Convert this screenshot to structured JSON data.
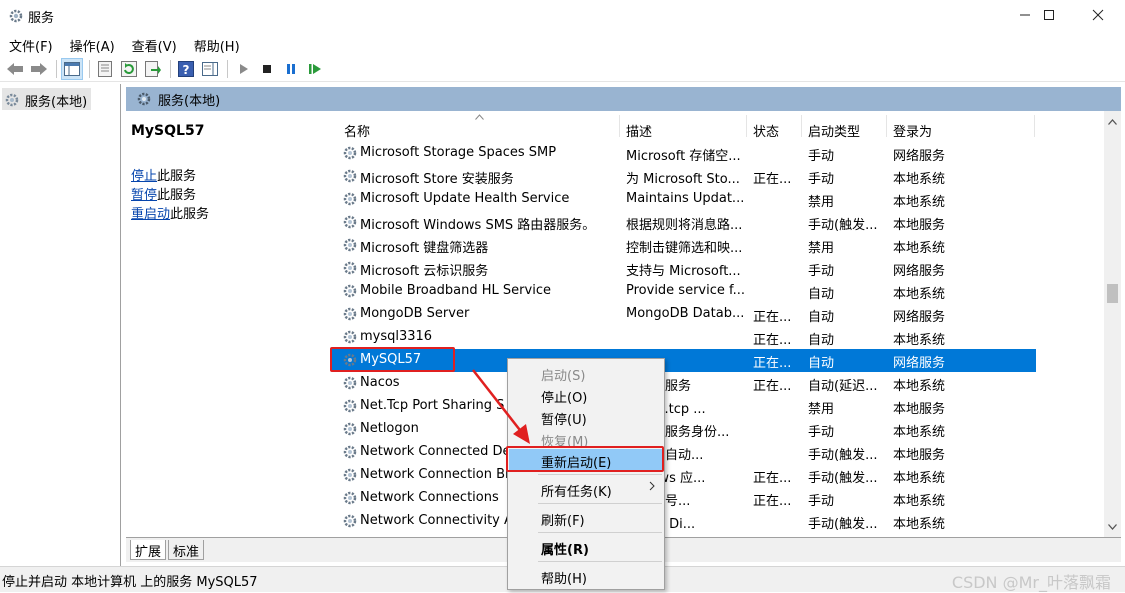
{
  "window": {
    "title": "服务",
    "min_icon": "minimize-icon",
    "max_icon": "maximize-icon",
    "close_icon": "close-icon"
  },
  "menubar": [
    "文件(F)",
    "操作(A)",
    "查看(V)",
    "帮助(H)"
  ],
  "tree": {
    "root_label": "服务(本地)"
  },
  "panel": {
    "header": "服务(本地)"
  },
  "detail": {
    "service_name": "MySQL57",
    "actions": [
      {
        "link": "停止",
        "rest": "此服务"
      },
      {
        "link": "暂停",
        "rest": "此服务"
      },
      {
        "link": "重启动",
        "rest": "此服务"
      }
    ]
  },
  "columns": {
    "name": "名称",
    "desc": "描述",
    "status": "状态",
    "start": "启动类型",
    "logon": "登录为"
  },
  "rows": [
    {
      "name": "Microsoft Storage Spaces SMP",
      "desc": "Microsoft 存储空...",
      "status": "",
      "start": "手动",
      "logon": "网络服务"
    },
    {
      "name": "Microsoft Store 安装服务",
      "desc": "为 Microsoft Sto...",
      "status": "正在...",
      "start": "手动",
      "logon": "本地系统"
    },
    {
      "name": "Microsoft Update Health Service",
      "desc": "Maintains Updat...",
      "status": "",
      "start": "禁用",
      "logon": "本地系统"
    },
    {
      "name": "Microsoft Windows SMS 路由器服务。",
      "desc": "根据规则将消息路...",
      "status": "",
      "start": "手动(触发...",
      "logon": "本地服务"
    },
    {
      "name": "Microsoft 键盘筛选器",
      "desc": "控制击键筛选和映...",
      "status": "",
      "start": "禁用",
      "logon": "本地系统"
    },
    {
      "name": "Microsoft 云标识服务",
      "desc": "支持与 Microsoft...",
      "status": "",
      "start": "手动",
      "logon": "网络服务"
    },
    {
      "name": "Mobile Broadband HL Service",
      "desc": "Provide service f...",
      "status": "",
      "start": "自动",
      "logon": "本地系统"
    },
    {
      "name": "MongoDB Server",
      "desc": "MongoDB Datab...",
      "status": "正在...",
      "start": "自动",
      "logon": "网络服务"
    },
    {
      "name": "mysql3316",
      "desc": "",
      "status": "正在...",
      "start": "自动",
      "logon": "本地系统"
    },
    {
      "name": "MySQL57",
      "desc": "",
      "status": "正在...",
      "start": "自动",
      "logon": "网络服务"
    },
    {
      "name": "Nacos",
      "desc": "自启动服务",
      "status": "正在...",
      "start": "自动(延迟...",
      "logon": "本地系统"
    },
    {
      "name": "Net.Tcp Port Sharing S",
      "desc": "过 net.tcp ...",
      "status": "",
      "start": "禁用",
      "logon": "本地服务"
    },
    {
      "name": "Netlogon",
      "desc": "服务器服务身份...",
      "status": "",
      "start": "手动",
      "logon": "本地系统"
    },
    {
      "name": "Network Connected De",
      "desc": "接设备自动...",
      "status": "",
      "start": "手动(触发...",
      "logon": "本地服务"
    },
    {
      "name": "Network Connection Br",
      "desc": "/indows 应...",
      "status": "正在...",
      "start": "手动(触发...",
      "logon": "本地系统"
    },
    {
      "name": "Network Connections",
      "desc": "络和拨号...",
      "status": "正在...",
      "start": "手动",
      "logon": "本地系统"
    },
    {
      "name": "Network Connectivity A",
      "desc": "组件的 Di...",
      "status": "",
      "start": "手动(触发...",
      "logon": "本地系统"
    }
  ],
  "selected_row": "MySQL57",
  "tabs": [
    "扩展",
    "标准"
  ],
  "status_text": "停止并启动 本地计算机 上的服务 MySQL57",
  "watermark": "CSDN @Mr_叶落飘霜",
  "context_menu": [
    {
      "label": "启动(S)",
      "state": "disabled"
    },
    {
      "label": "停止(O)",
      "state": "normal"
    },
    {
      "label": "暂停(U)",
      "state": "normal"
    },
    {
      "label": "恢复(M)",
      "state": "disabled"
    },
    {
      "label": "重新启动(E)",
      "state": "highlighted"
    },
    {
      "label": "所有任务(K)",
      "state": "submenu"
    },
    {
      "label": "刷新(F)",
      "state": "normal"
    },
    {
      "label": "属性(R)",
      "state": "bold"
    },
    {
      "label": "帮助(H)",
      "state": "normal"
    }
  ],
  "colors": {
    "selection": "#0078d7",
    "header": "#99b4d1",
    "menu_highlight": "#91c9f7",
    "annotation": "#e02020"
  }
}
